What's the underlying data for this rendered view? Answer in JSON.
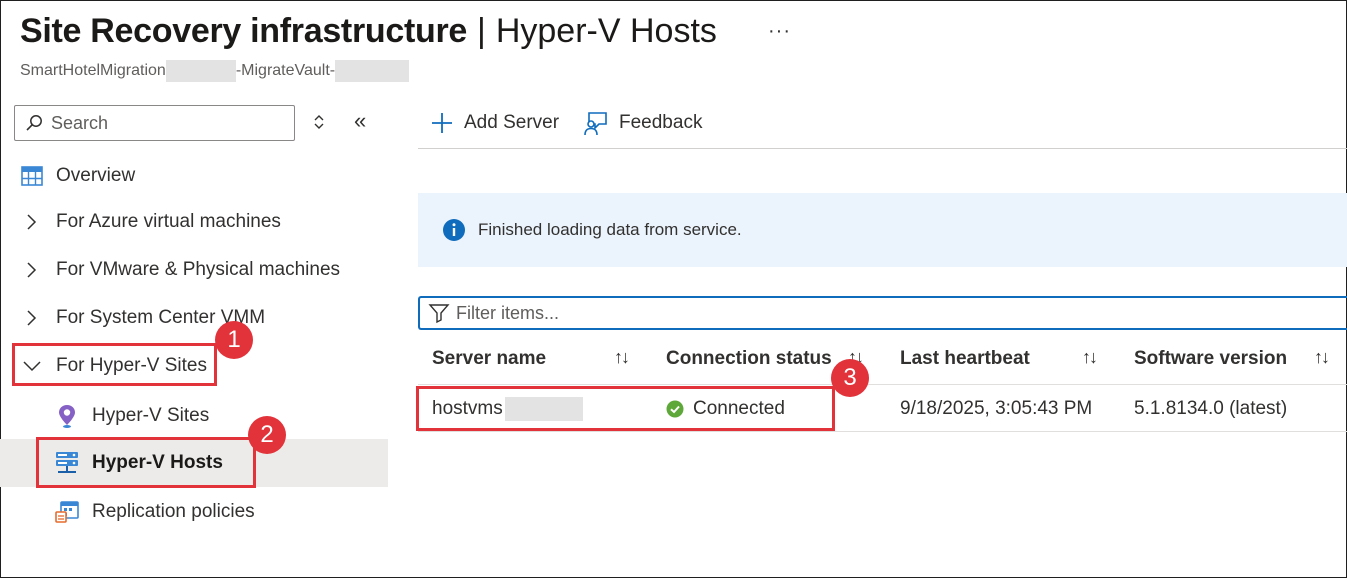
{
  "header": {
    "title_bold": "Site Recovery infrastructure",
    "title_separator": "|",
    "title_light": "Hyper-V Hosts",
    "more_label": "···",
    "subtitle_part1": "SmartHotelMigration",
    "subtitle_part2": "-MigrateVault-"
  },
  "sidebar": {
    "search_placeholder": "Search",
    "collapse_label": "«",
    "items": [
      {
        "label": "Overview",
        "icon": "overview-grid-icon"
      },
      {
        "label": "For Azure virtual machines",
        "icon": "chevron-right-icon"
      },
      {
        "label": "For VMware & Physical machines",
        "icon": "chevron-right-icon"
      },
      {
        "label": "For System Center VMM",
        "icon": "chevron-right-icon"
      },
      {
        "label": "For Hyper-V Sites",
        "icon": "chevron-down-icon",
        "expanded": true
      }
    ],
    "subitems": [
      {
        "label": "Hyper-V Sites",
        "icon": "map-pin-icon"
      },
      {
        "label": "Hyper-V Hosts",
        "icon": "server-icon",
        "selected": true
      },
      {
        "label": "Replication policies",
        "icon": "calendar-policy-icon"
      }
    ]
  },
  "commands": {
    "add_server": "Add Server",
    "feedback": "Feedback"
  },
  "banner": {
    "message": "Finished loading data from service."
  },
  "filter": {
    "placeholder": "Filter items..."
  },
  "table": {
    "columns": [
      "Server name",
      "Connection status",
      "Last heartbeat",
      "Software version"
    ],
    "sort_glyph": "↑↓",
    "rows": [
      {
        "server_name": "hostvms",
        "connection_status": "Connected",
        "last_heartbeat": "9/18/2025, 3:05:43 PM",
        "software_version": "5.1.8134.0 (latest)"
      }
    ]
  },
  "annotations": {
    "badge1": "1",
    "badge2": "2",
    "badge3": "3"
  },
  "colors": {
    "accent": "#0f6cbd",
    "annotation": "#e2323a",
    "success": "#5ea83a",
    "banner_bg": "#ebf3fc",
    "selected_bg": "#edebe9"
  }
}
